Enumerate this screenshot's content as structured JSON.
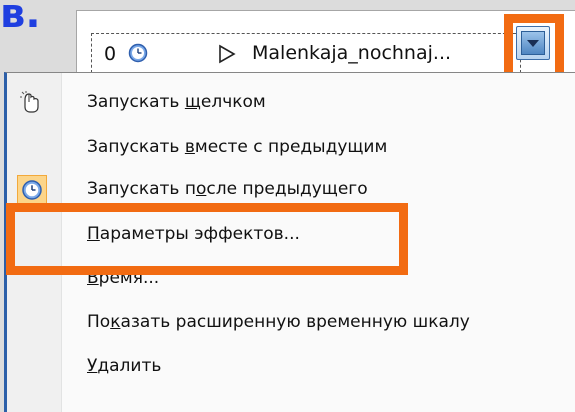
{
  "step_letter": "в.",
  "animation_row": {
    "index": "0",
    "name": "Malenkaja_nochnaj..."
  },
  "menu": {
    "items": [
      {
        "pre": "Запускать ",
        "mnemonic": "щ",
        "post": "елчком",
        "icon": "mouse-click-icon"
      },
      {
        "pre": "Запускать ",
        "mnemonic": "в",
        "post": "месте с предыдущим",
        "icon": ""
      },
      {
        "pre": "Запускать п",
        "mnemonic": "о",
        "post": "сле предыдущего",
        "icon": "clock-icon",
        "checked": true
      },
      {
        "pre": "",
        "mnemonic": "П",
        "post": "араметры эффектов...",
        "icon": ""
      },
      {
        "pre": "",
        "mnemonic": "В",
        "post": "ремя...",
        "icon": ""
      },
      {
        "pre": "По",
        "mnemonic": "к",
        "post": "азать расширенную временную шкалу",
        "icon": ""
      },
      {
        "pre": "",
        "mnemonic": "У",
        "post": "далить",
        "icon": ""
      }
    ]
  },
  "colors": {
    "highlight_box": "#f26b12",
    "step_letter": "#1f3fe0",
    "menu_border": "#2c5fa8"
  }
}
